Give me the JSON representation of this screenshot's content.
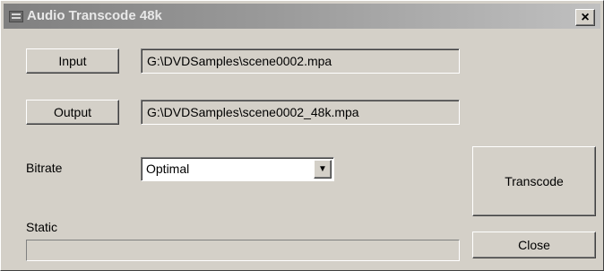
{
  "window": {
    "title": "Audio Transcode 48k",
    "close_glyph": "×",
    "icon": "app-menu-icon"
  },
  "input": {
    "button_label": "Input",
    "path": "G:\\DVDSamples\\scene0002.mpa"
  },
  "output": {
    "button_label": "Output",
    "path": "G:\\DVDSamples\\scene0002_48k.mpa"
  },
  "bitrate": {
    "label": "Bitrate",
    "selected": "Optimal",
    "arrow_glyph": "▼"
  },
  "status": {
    "label": "Static",
    "progress_fraction": 0
  },
  "actions": {
    "transcode_label": "Transcode",
    "close_label": "Close"
  }
}
